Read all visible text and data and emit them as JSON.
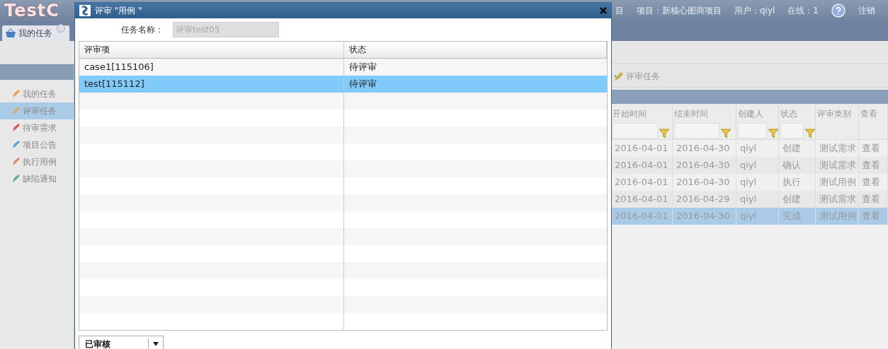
{
  "app": {
    "logo": "TestC",
    "header_fragment": "目",
    "project": "项目：新核心图商项目",
    "user": "用户：qiyl",
    "online": "在线：1",
    "logout": "注销"
  },
  "tabs": [
    {
      "label": "我的任务",
      "selected": true
    }
  ],
  "sidebar": {
    "items": [
      {
        "label": "我的任务",
        "selected": false
      },
      {
        "label": "评审任务",
        "selected": true
      },
      {
        "label": "待审需求",
        "selected": false
      },
      {
        "label": "项目公告",
        "selected": false
      },
      {
        "label": "执行用例",
        "selected": false
      },
      {
        "label": "缺陷通知",
        "selected": false
      }
    ]
  },
  "toolbar": {
    "buttons": [
      "评审任务"
    ]
  },
  "task_table": {
    "columns": [
      {
        "label": "开始时间",
        "filter": true
      },
      {
        "label": "结束时间",
        "filter": true
      },
      {
        "label": "创建人",
        "filter": true
      },
      {
        "label": "状态",
        "filter": true
      },
      {
        "label": "评审类别",
        "filter": false
      },
      {
        "label": "查看",
        "filter": false
      }
    ],
    "rows": [
      {
        "cells": [
          "2016-04-01",
          "2016-04-30",
          "qiyl",
          "创建",
          "测试需求",
          "查看"
        ],
        "selected": false
      },
      {
        "cells": [
          "2016-04-01",
          "2016-04-30",
          "qiyl",
          "确认",
          "测试需求",
          "查看"
        ],
        "selected": false
      },
      {
        "cells": [
          "2016-04-01",
          "2016-04-30",
          "qiyl",
          "执行",
          "测试用例",
          "查看"
        ],
        "selected": false
      },
      {
        "cells": [
          "2016-04-01",
          "2016-04-29",
          "qiyl",
          "创建",
          "测试需求",
          "查看"
        ],
        "selected": false
      },
      {
        "cells": [
          "2016-04-01",
          "2016-04-30",
          "qiyl",
          "完成",
          "测试用例",
          "查看"
        ],
        "selected": true
      }
    ]
  },
  "dialog": {
    "title": "评审 \"用例 \"",
    "task_name_label": "任务名称：",
    "task_name_value": "评审test05",
    "task_name_disabled": true,
    "columns": [
      "评审项",
      "状态"
    ],
    "rows": [
      {
        "cells": [
          "case1[115106]",
          "待评审"
        ],
        "selected": false
      },
      {
        "cells": [
          "test[115112]",
          "待评审"
        ],
        "selected": true
      }
    ],
    "review_result": "已审核"
  }
}
